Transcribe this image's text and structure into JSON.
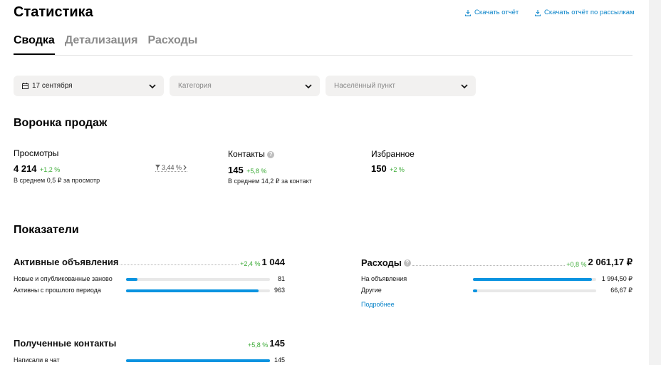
{
  "header": {
    "title": "Статистика",
    "download_report": "Скачать отчёт",
    "download_mailing_report": "Скачать отчёт по рассылкам"
  },
  "tabs": [
    {
      "label": "Сводка",
      "active": true
    },
    {
      "label": "Детализация",
      "active": false
    },
    {
      "label": "Расходы",
      "active": false
    }
  ],
  "filters": {
    "date": "17 сентября",
    "category_placeholder": "Категория",
    "locality_placeholder": "Населённый пункт"
  },
  "funnel": {
    "title": "Воронка продаж",
    "views": {
      "label": "Просмотры",
      "value": "4 214",
      "delta": "+1,2 %",
      "avg": "В среднем 0,5 ₽ за просмотр"
    },
    "conversion": "3,44 %",
    "contacts": {
      "label": "Контакты",
      "value": "145",
      "delta": "+5,8 %",
      "avg": "В среднем 14,2 ₽ за контакт"
    },
    "favorites": {
      "label": "Избранное",
      "value": "150",
      "delta": "+2 %"
    }
  },
  "indicators": {
    "title": "Показатели",
    "active_ads": {
      "label": "Активные объявления",
      "delta": "+2,4 %",
      "value": "1 044",
      "rows": [
        {
          "label": "Новые и опубликованные заново",
          "value": "81",
          "fraction": 0.078
        },
        {
          "label": "Активны с прошлого периода",
          "value": "963",
          "fraction": 0.922
        }
      ]
    },
    "expenses": {
      "label": "Расходы",
      "delta": "+0,8 %",
      "value": "2 061,17 ₽",
      "rows": [
        {
          "label": "На объявления",
          "value": "1 994,50 ₽",
          "fraction": 0.968
        },
        {
          "label": "Другие",
          "value": "66,67 ₽",
          "fraction": 0.032
        }
      ],
      "more_link": "Подробнее"
    },
    "received_contacts": {
      "label": "Полученные контакты",
      "delta": "+5,8 %",
      "value": "145",
      "rows": [
        {
          "label": "Написали в чат",
          "value": "145",
          "fraction": 1.0
        }
      ]
    }
  },
  "colors": {
    "accent": "#0a93e0",
    "link": "#0a84c9",
    "positive": "#3aaa35"
  }
}
